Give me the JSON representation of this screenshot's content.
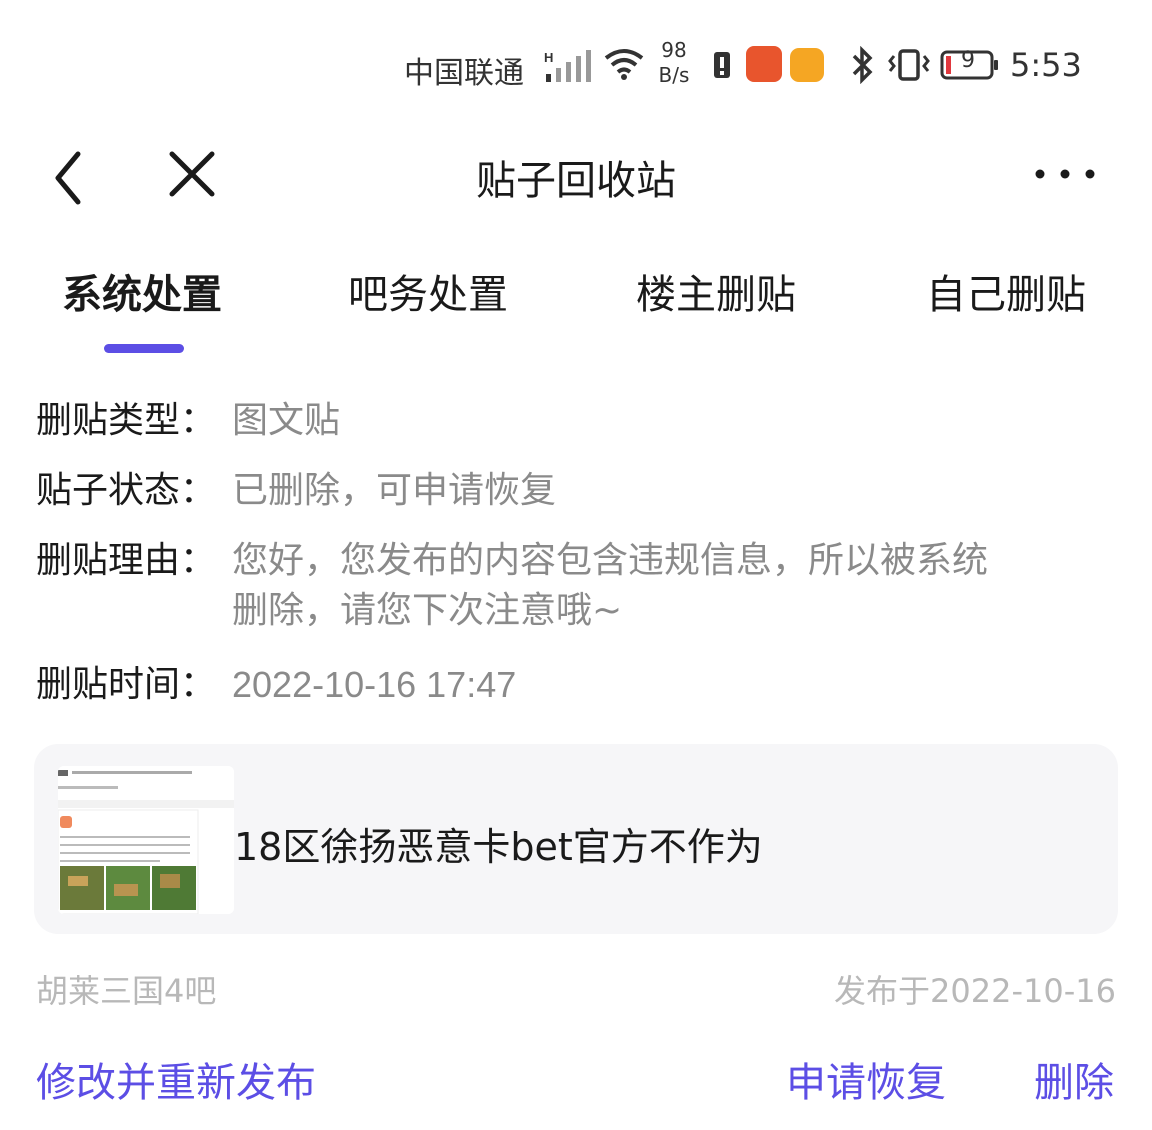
{
  "status_bar": {
    "carrier": "中国联通",
    "net_speed_value": "98",
    "net_speed_unit": "B/s",
    "battery": "9",
    "time": "5:53",
    "icons": [
      "signal-icon",
      "wifi-icon",
      "alert-icon",
      "taobao-app-icon",
      "coffee-app-icon",
      "bluetooth-icon",
      "vibrate-icon",
      "battery-icon"
    ]
  },
  "header": {
    "title": "贴子回收站",
    "icons": [
      "back-icon",
      "close-icon",
      "more-icon"
    ]
  },
  "tabs": [
    {
      "label": "系统处置",
      "active": true
    },
    {
      "label": "吧务处置",
      "active": false
    },
    {
      "label": "楼主删贴",
      "active": false
    },
    {
      "label": "自己删贴",
      "active": false
    }
  ],
  "accent_color": "#5c4ee5",
  "info": {
    "type_label": "删贴类型：",
    "type_value": "图文贴",
    "status_label": "贴子状态：",
    "status_value": "已删除，可申请恢复",
    "reason_label": "删贴理由：",
    "reason_value": "您好，您发布的内容包含违规信息，所以被系统删除，请您下次注意哦~",
    "time_label": "删贴时间：",
    "time_value": "2022-10-16 17:47"
  },
  "post": {
    "title": "18区徐扬恶意卡bet官方不作为",
    "forum": "胡莱三国4吧",
    "published": "发布于2022-10-16"
  },
  "actions": {
    "edit_republish": "修改并重新发布",
    "restore": "申请恢复",
    "delete": "删除"
  }
}
